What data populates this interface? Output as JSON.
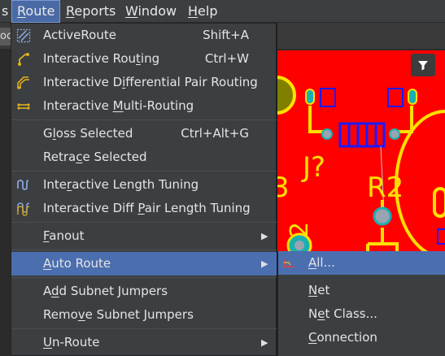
{
  "menubar": {
    "items": [
      {
        "label": "s",
        "underline": ""
      },
      {
        "label": "Route",
        "underline": "R"
      },
      {
        "label": "Reports",
        "underline": "R"
      },
      {
        "label": "Window",
        "underline": "W"
      },
      {
        "label": "Help",
        "underline": "H"
      }
    ],
    "active": "Route"
  },
  "doc_tab": {
    "label": "oc"
  },
  "route_menu": {
    "items": [
      {
        "pre": "Active",
        "key": "",
        "post": "Route",
        "shortcut": "Shift+A",
        "icon": "active-route-icon"
      },
      {
        "pre": "Interactive Rou",
        "key": "t",
        "post": "ing",
        "shortcut": "Ctrl+W",
        "icon": "interactive-routing-icon"
      },
      {
        "pre": "Interactive D",
        "key": "i",
        "post": "fferential Pair Routing",
        "shortcut": "",
        "icon": "diff-pair-routing-icon"
      },
      {
        "pre": "Interactive ",
        "key": "M",
        "post": "ulti-Routing",
        "shortcut": "",
        "icon": "multi-routing-icon"
      },
      {
        "pre": "G",
        "key": "l",
        "post": "oss Selected",
        "shortcut": "Ctrl+Alt+G",
        "icon": ""
      },
      {
        "pre": "Retra",
        "key": "c",
        "post": "e Selected",
        "shortcut": "",
        "icon": ""
      },
      {
        "pre": "Inte",
        "key": "r",
        "post": "active Length Tuning",
        "shortcut": "",
        "icon": "length-tuning-icon"
      },
      {
        "pre": "Interactive Diff ",
        "key": "P",
        "post": "air Length Tuning",
        "shortcut": "",
        "icon": "diff-pair-length-tuning-icon"
      },
      {
        "pre": "",
        "key": "F",
        "post": "anout",
        "shortcut": "",
        "icon": "",
        "submenu": true
      },
      {
        "pre": "",
        "key": "A",
        "post": "uto Route",
        "shortcut": "",
        "icon": "",
        "submenu": true,
        "highlighted": true
      },
      {
        "pre": "A",
        "key": "d",
        "post": "d Subnet Jumpers",
        "shortcut": "",
        "icon": ""
      },
      {
        "pre": "Remo",
        "key": "v",
        "post": "e Subnet Jumpers",
        "shortcut": "",
        "icon": ""
      },
      {
        "pre": "",
        "key": "U",
        "post": "n-Route",
        "shortcut": "",
        "icon": "",
        "submenu": true
      }
    ]
  },
  "auto_route_submenu": {
    "items": [
      {
        "pre": "",
        "key": "A",
        "post": "ll...",
        "icon": "auto-route-all-icon",
        "highlighted": true
      },
      {
        "pre": "",
        "key": "N",
        "post": "et",
        "icon": ""
      },
      {
        "pre": "N",
        "key": "e",
        "post": "t Class...",
        "icon": ""
      },
      {
        "pre": "",
        "key": "C",
        "post": "onnection",
        "icon": ""
      }
    ]
  },
  "pcb": {
    "labels": [
      "J?",
      "R2",
      "3",
      "2"
    ],
    "colors": {
      "board": "#ff0000",
      "silkscreen": "#ffe000",
      "pad": "#9aa3b2",
      "outline": "#1a1aff"
    }
  },
  "colors": {
    "menu_bg": "#3c3f41",
    "highlight": "#4b6eaf",
    "text": "#e4e4e4"
  }
}
